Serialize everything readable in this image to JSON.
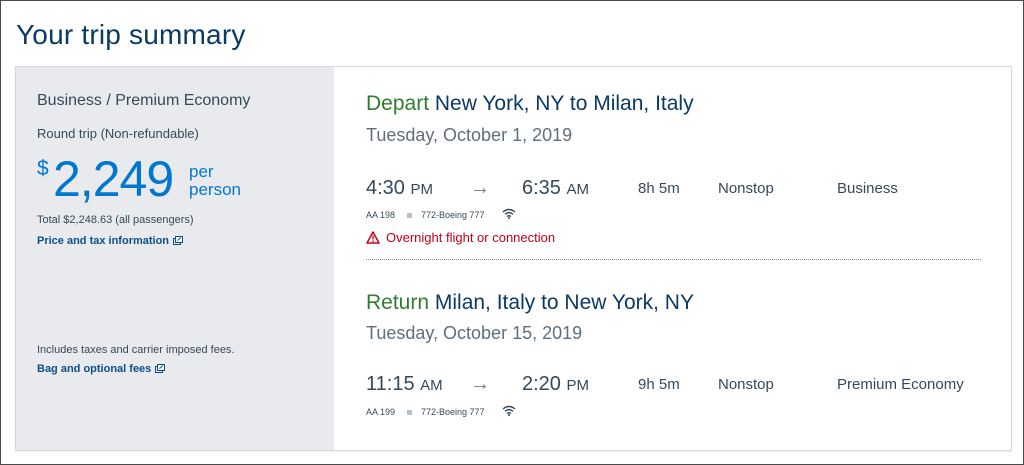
{
  "page": {
    "title": "Your trip summary"
  },
  "summary": {
    "cabin": "Business / Premium Economy",
    "trip_type": "Round trip (Non-refundable)",
    "currency_symbol": "$",
    "price": "2,249",
    "per_person": "per person",
    "total": "Total $2,248.63 (all passengers)",
    "price_link": "Price and tax information",
    "fees_note": "Includes taxes and carrier imposed fees.",
    "bag_link": "Bag and optional fees"
  },
  "segments": [
    {
      "direction": "Depart",
      "route": "New York, NY to Milan, Italy",
      "date": "Tuesday, October 1, 2019",
      "depart_time": "4:30",
      "depart_ampm": "PM",
      "arrive_time": "6:35",
      "arrive_ampm": "AM",
      "duration": "8h  5m",
      "stops": "Nonstop",
      "cabin": "Business",
      "flight": "AA 198",
      "aircraft": "772-Boeing 777",
      "warning": "Overnight flight or connection"
    },
    {
      "direction": "Return",
      "route": "Milan, Italy to New York, NY",
      "date": "Tuesday, October 15, 2019",
      "depart_time": "11:15",
      "depart_ampm": "AM",
      "arrive_time": "2:20",
      "arrive_ampm": "PM",
      "duration": "9h  5m",
      "stops": "Nonstop",
      "cabin": "Premium Economy",
      "flight": "AA 199",
      "aircraft": "772-Boeing 777"
    }
  ],
  "icons": {
    "external_link": "external-link-icon",
    "wifi": "wifi-icon",
    "warning": "warning-triangle-icon",
    "arrow": "right-arrow-icon"
  },
  "colors": {
    "title": "#0b3a64",
    "price": "#0078d2",
    "direction": "#2f7d2f",
    "warning": "#c30019",
    "left_panel": "#e8eaed"
  }
}
